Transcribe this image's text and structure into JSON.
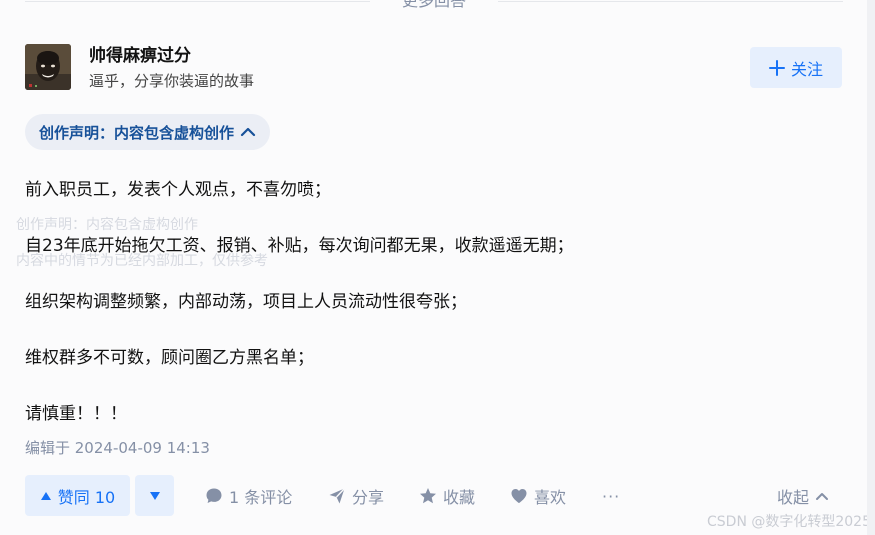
{
  "divider": {
    "label": "更多回答"
  },
  "author": {
    "name": "帅得麻痹过分",
    "bio": "逼乎，分享你装逼的故事",
    "follow_label": "关注"
  },
  "declaration": {
    "label": "创作声明：内容包含虚构创作"
  },
  "ghost_overlay": {
    "line1": "创作声明：内容包含虚构创作",
    "line2": "内容中的情节为已经内部加工，仅供参考"
  },
  "content": {
    "paragraphs": [
      "前入职员工，发表个人观点，不喜勿喷；",
      "自23年底开始拖欠工资、报销、补贴，每次询问都无果，收款遥遥无期；",
      "组织架构调整频繁，内部动荡，项目上人员流动性很夸张；",
      "维权群多不可数，顾问圈乙方黑名单；",
      "请慎重！！！"
    ],
    "edit_time": "编辑于 2024-04-09 14:13"
  },
  "actions": {
    "vote_up_label": "赞同 10",
    "comment_label": "1 条评论",
    "share_label": "分享",
    "favorite_label": "收藏",
    "like_label": "喜欢",
    "more_label": "···",
    "collapse_label": "收起"
  },
  "watermark": "CSDN @数字化转型2025",
  "colors": {
    "brand_blue": "#1772f6",
    "chip_text": "#175199",
    "meta_gray": "#8590a6"
  }
}
